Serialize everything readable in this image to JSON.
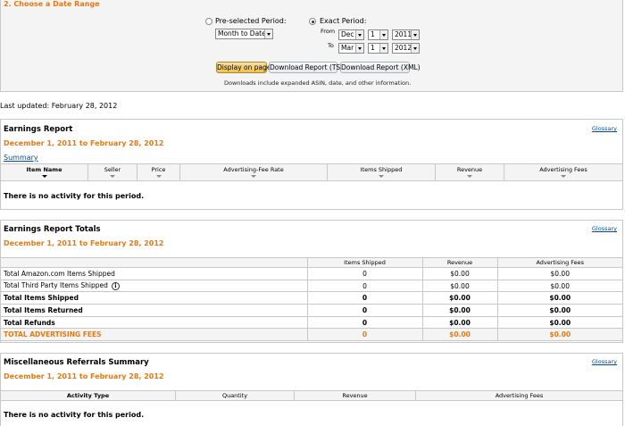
{
  "date_range": {
    "title": "2. Choose a Date Range",
    "preselected_label": "Pre-selected Period:",
    "preselected_value": "Month to Date",
    "exact_label": "Exact Period:",
    "from_label": "From",
    "to_label": "To",
    "from": {
      "month": "Dec",
      "day": "1",
      "year": "2011"
    },
    "to": {
      "month": "Mar",
      "day": "1",
      "year": "2012"
    },
    "display_button": "Display on page",
    "download_tsv": "Download Report (TSV)",
    "download_xml": "Download Report (XML)",
    "downloads_note": "Downloads include expanded ASIN, date, and other information."
  },
  "last_updated": "Last updated: February 28, 2012",
  "glossary_label": "Glossary",
  "earnings_report": {
    "title": "Earnings Report",
    "period": "December 1, 2011 to February 28, 2012",
    "summary_link": "Summary",
    "columns": [
      "Item Name",
      "Seller",
      "Price",
      "Advertising-Fee Rate",
      "Items Shipped",
      "Revenue",
      "Advertising Fees"
    ],
    "empty_message": "There is no activity for this period."
  },
  "totals": {
    "title": "Earnings Report Totals",
    "period": "December 1, 2011 to February 28, 2012",
    "columns": [
      "",
      "Items Shipped",
      "Revenue",
      "Advertising Fees"
    ],
    "rows": [
      {
        "label": "Total Amazon.com Items Shipped",
        "shipped": "0",
        "revenue": "$0.00",
        "fees": "$0.00"
      },
      {
        "label": "Total Third Party Items Shipped",
        "shipped": "0",
        "revenue": "$0.00",
        "fees": "$0.00"
      },
      {
        "label": "Total Items Shipped",
        "shipped": "0",
        "revenue": "$0.00",
        "fees": "$0.00"
      },
      {
        "label": "Total Items Returned",
        "shipped": "0",
        "revenue": "$0.00",
        "fees": "$0.00"
      },
      {
        "label": "Total Refunds",
        "shipped": "0",
        "revenue": "$0.00",
        "fees": "$0.00"
      },
      {
        "label": "TOTAL ADVERTISING FEES",
        "shipped": "0",
        "revenue": "$0.00",
        "fees": "$0.00"
      }
    ],
    "info_icon": "info-icon"
  },
  "misc": {
    "title": "Miscellaneous Referrals Summary",
    "period": "December 1, 2011 to February 28, 2012",
    "columns": [
      "Activity Type",
      "Quantity",
      "Revenue",
      "Advertising Fees"
    ],
    "empty_message": "There is no activity for this period."
  },
  "colors": {
    "accent": "#e47911",
    "link": "#004b91",
    "header_bg": "#f4f4f4",
    "border": "#c8c8c8"
  }
}
